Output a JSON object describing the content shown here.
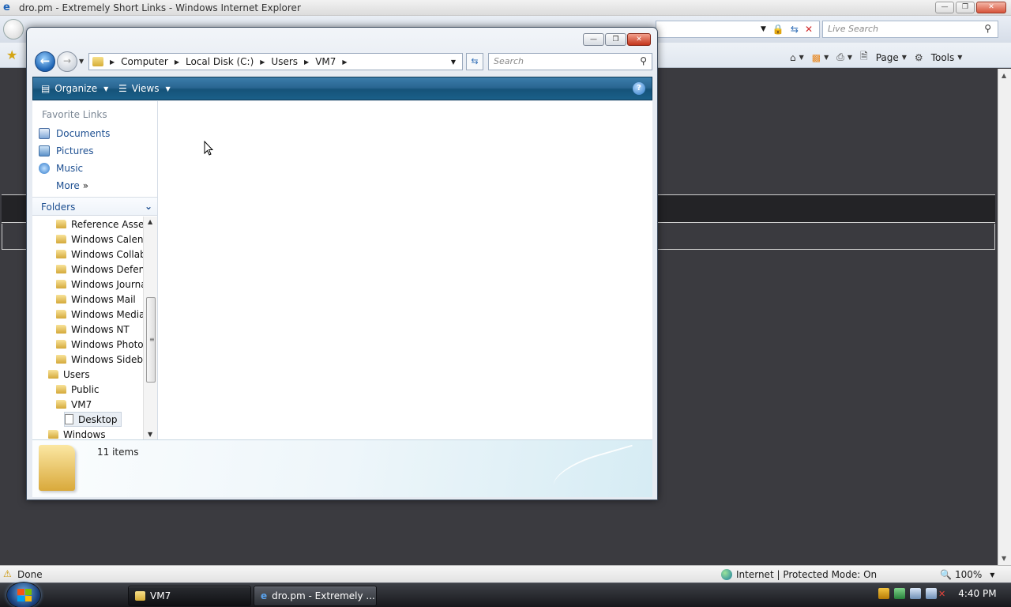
{
  "ie": {
    "title": "dro.pm - Extremely Short Links - Windows Internet Explorer",
    "search_placeholder": "Live Search",
    "commands": {
      "page": "Page",
      "tools": "Tools"
    },
    "status": {
      "done": "Done",
      "zone": "Internet | Protected Mode: On",
      "zoom": "100%"
    }
  },
  "explorer": {
    "breadcrumb": [
      "Computer",
      "Local Disk (C:)",
      "Users",
      "VM7"
    ],
    "search_placeholder": "Search",
    "toolbar": {
      "organize": "Organize",
      "views": "Views"
    },
    "favorites": {
      "header": "Favorite Links",
      "items": [
        {
          "label": "Documents",
          "icon": "documents-icon"
        },
        {
          "label": "Pictures",
          "icon": "pictures-icon"
        },
        {
          "label": "Music",
          "icon": "music-icon"
        }
      ],
      "more": "More"
    },
    "folders_header": "Folders",
    "tree": [
      {
        "label": "Reference Assem",
        "indent": 2
      },
      {
        "label": "Windows Calend",
        "indent": 2
      },
      {
        "label": "Windows Collab",
        "indent": 2
      },
      {
        "label": "Windows Defenc",
        "indent": 2
      },
      {
        "label": "Windows Journa",
        "indent": 2
      },
      {
        "label": "Windows Mail",
        "indent": 2
      },
      {
        "label": "Windows Media",
        "indent": 2
      },
      {
        "label": "Windows NT",
        "indent": 2
      },
      {
        "label": "Windows Photo",
        "indent": 2
      },
      {
        "label": "Windows Sideba",
        "indent": 2
      },
      {
        "label": "Users",
        "indent": 1
      },
      {
        "label": "Public",
        "indent": 2
      },
      {
        "label": "VM7",
        "indent": 2
      },
      {
        "label": "Desktop",
        "indent": 3,
        "selected": true
      },
      {
        "label": "Windows",
        "indent": 1
      }
    ],
    "details": {
      "item_count": "11 items"
    }
  },
  "taskbar": {
    "buttons": [
      {
        "label": "VM7",
        "icon": "folder-icon",
        "active": true
      },
      {
        "label": "dro.pm - Extremely ...",
        "icon": "ie-icon",
        "active": false
      }
    ],
    "clock": "4:40 PM"
  },
  "colors": {
    "explorer_toolbar": "#1a5f89",
    "link_blue": "#1d4f91",
    "page_background": "#3a3a3f"
  }
}
